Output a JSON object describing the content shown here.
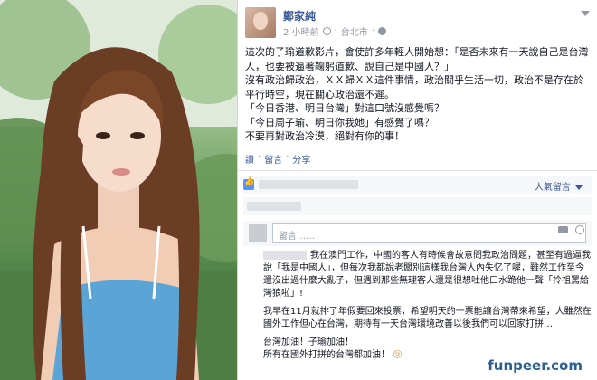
{
  "post": {
    "author": "鄭家純",
    "time": "2 小時前",
    "location": "台北市",
    "paragraphs": [
      "這次的子瑜道歉影片，會使許多年輕人開始想：「是否未來有一天說自己是台灣人，也要被逼著鞠躬道歉、說自己是中國人？」",
      "沒有政治歸政治，ＸＸ歸ＸＸ這件事情，政治關乎生活一切，政治不是存在於平行時空，現在關心政治還不遲。",
      "「今日香港、明日台灣」對這口號沒感覺嗎？",
      "「今日周子瑜、明日你我她」有感覺了嗎？",
      "不要再對政治冷漠，絕對有你的事！"
    ],
    "actions": [
      "讚",
      "留言",
      "分享"
    ]
  },
  "likes": {
    "top_comments_label": "人氣留言"
  },
  "comment_box": {
    "placeholder": "留言……"
  },
  "reply": {
    "paragraphs": [
      "我在澳門工作，中國的客人有時候會故意問我政治問題，甚至有過逼我說「我是中國人」，但每次我都說老闆別這樣我台灣人內失忆了喔，雖然工作至今還沒出過什麼大亂子，但遇到那些無理客人還是很想吐他口水跪他一聲「拎祖罵給灣狼啦」!",
      "我早在11月就排了年假要回來投票，希望明天的一票能讓台灣帶來希望，人雖然在國外工作但心在台灣，期待有一天台灣環境改善以後我們可以回家打拼…",
      "台灣加油！子瑜加油！",
      "所有在國外打拼的台灣都加油！"
    ],
    "emoji": "😢"
  },
  "watermark": "funpeer.com",
  "colors": {
    "link_blue": "#3b5998",
    "meta_gray": "#9197a3",
    "watermark": "#2b5f8f"
  }
}
